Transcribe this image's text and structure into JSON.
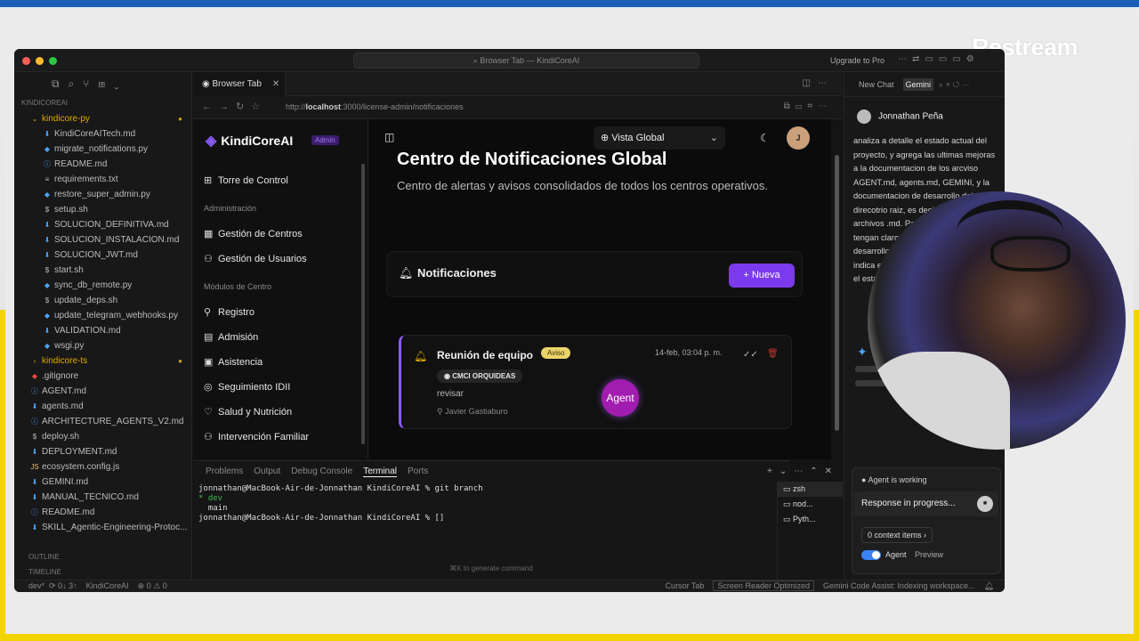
{
  "overlay": {
    "brand": "Restream"
  },
  "ide": {
    "command_center": "Browser Tab — KindiCoreAI",
    "upgrade": "Upgrade to Pro",
    "explorer": {
      "section": "KINDICOREAI",
      "items": [
        {
          "label": "kindicore-py",
          "type": "folder-open",
          "modified": "●"
        },
        {
          "label": "KindiCoreAITech.md",
          "type": "md"
        },
        {
          "label": "migrate_notifications.py",
          "type": "py"
        },
        {
          "label": "README.md",
          "type": "info"
        },
        {
          "label": "requirements.txt",
          "type": "txt"
        },
        {
          "label": "restore_super_admin.py",
          "type": "py"
        },
        {
          "label": "setup.sh",
          "type": "sh"
        },
        {
          "label": "SOLUCION_DEFINITIVA.md",
          "type": "md"
        },
        {
          "label": "SOLUCION_INSTALACION.md",
          "type": "md"
        },
        {
          "label": "SOLUCION_JWT.md",
          "type": "md"
        },
        {
          "label": "start.sh",
          "type": "sh"
        },
        {
          "label": "sync_db_remote.py",
          "type": "py"
        },
        {
          "label": "update_deps.sh",
          "type": "sh"
        },
        {
          "label": "update_telegram_webhooks.py",
          "type": "py"
        },
        {
          "label": "VALIDATION.md",
          "type": "md"
        },
        {
          "label": "wsgi.py",
          "type": "py"
        },
        {
          "label": "kindicore-ts",
          "type": "folder",
          "modified": "●"
        },
        {
          "label": ".gitignore",
          "type": "git"
        },
        {
          "label": "AGENT.md",
          "type": "info"
        },
        {
          "label": "agents.md",
          "type": "md"
        },
        {
          "label": "ARCHITECTURE_AGENTS_V2.md",
          "type": "info"
        },
        {
          "label": "deploy.sh",
          "type": "sh"
        },
        {
          "label": "DEPLOYMENT.md",
          "type": "md"
        },
        {
          "label": "ecosystem.config.js",
          "type": "js"
        },
        {
          "label": "GEMINI.md",
          "type": "md"
        },
        {
          "label": "MANUAL_TECNICO.md",
          "type": "md"
        },
        {
          "label": "README.md",
          "type": "info"
        },
        {
          "label": "SKILL_Agentic-Engineering-Protoc...",
          "type": "md"
        }
      ],
      "footer": [
        "OUTLINE",
        "TIMELINE"
      ]
    },
    "browser": {
      "tab_label": "Browser Tab",
      "url_prefix": "http://",
      "url_host": "localhost",
      "url_rest": ":3000/license-admin/notificaciones"
    },
    "terminal": {
      "tabs": [
        "Problems",
        "Output",
        "Debug Console",
        "Terminal",
        "Ports"
      ],
      "active_tab": "Terminal",
      "lines": [
        "jonnathan@MacBook-Air-de-Jonnathan KindiCoreAI % git branch",
        "* dev",
        "  main",
        "jonnathan@MacBook-Air-de-Jonnathan KindiCoreAI % []"
      ],
      "hint": "⌘K to generate command",
      "sessions": [
        "zsh",
        "nod...",
        "Pyth..."
      ]
    },
    "chat": {
      "new_chat": "New Chat",
      "active_tab": "Gemini",
      "user": "Jonnathan Peña",
      "message": "analiza a detalle el estado actual del proyecto, y agrega las ultimas mejoras a la documentacion de los arcviso AGENT.md, agents.md, GEMINI, y la documentacion de desarrollo del direcotrio raiz, es decir todos los archivos .md. Para que los agentes tengan claro el estado actual del desarrollo, no modifiques codigo, solo indica en la documentacion basado en el estado actual de las ramas main",
      "status": "Agent is working",
      "response": "Response in progress...",
      "context": "0 context items",
      "agent_label": "Agent",
      "preview_label": "Preview"
    },
    "statusbar": {
      "branch": "dev*",
      "sync": "⟳ 0↓ 3↑",
      "project": "KindiCoreAI",
      "problems": "⊗ 0 ⚠ 0",
      "cursor_tab": "Cursor Tab",
      "screen_reader": "Screen Reader Optimized",
      "gemini": "Gemini Code Assist: Indexing workspace..."
    }
  },
  "app": {
    "brand": "KindiCoreAI",
    "badge": "Admin",
    "nav": {
      "torre": "Torre de Control",
      "section_admin": "Administración",
      "gestion_centros": "Gestión de Centros",
      "gestion_usuarios": "Gestión de Usuarios",
      "section_modulos": "Módulos de Centro",
      "registro": "Registro",
      "admision": "Admisión",
      "asistencia": "Asistencia",
      "seguimiento": "Seguimiento IDII",
      "salud": "Salud y Nutrición",
      "intervencion": "Intervención Familiar"
    },
    "topbar": {
      "scope": "Vista Global",
      "avatar_initial": "J"
    },
    "page_title": "Centro de Notificaciones Global",
    "page_subtitle": "Centro de alertas y avisos consolidados de todos los centros operativos.",
    "notifications_header": "Notificaciones",
    "new_button": "Nueva",
    "notification": {
      "title": "Reunión de equipo",
      "tag": "Aviso",
      "date": "14-feb, 03:04 p. m.",
      "center": "CMCI ORQUIDEAS",
      "body": "revisar",
      "author": "Javier Gastiaburo"
    },
    "agent_fab": "Agent"
  },
  "colors": {
    "accent": "#7c3aed",
    "warning_tag": "#ead36a",
    "restream_blue": "#1a5fb4",
    "restream_yellow": "#f3d400"
  }
}
